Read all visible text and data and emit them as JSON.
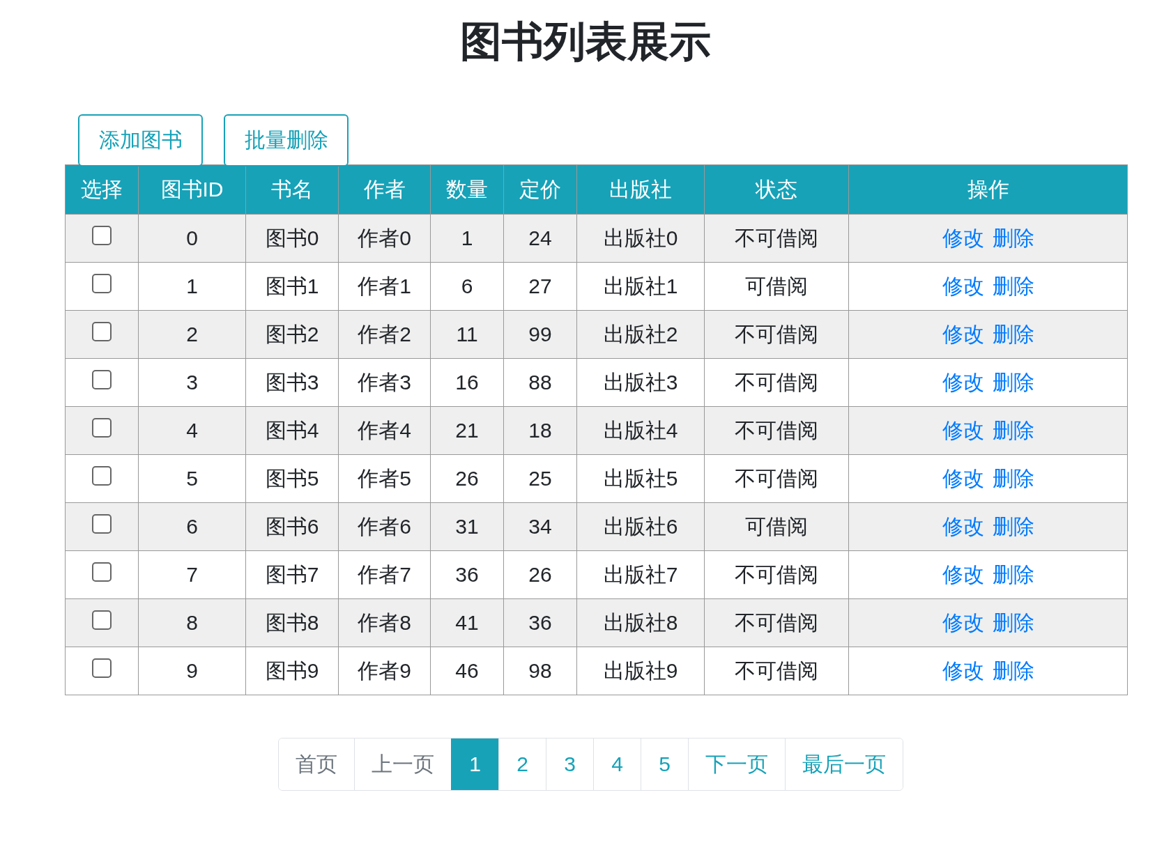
{
  "title": "图书列表展示",
  "toolbar": {
    "buttons": [
      "添加图书",
      "批量删除"
    ]
  },
  "table": {
    "columns": [
      "选择",
      "图书ID",
      "书名",
      "作者",
      "数量",
      "定价",
      "出版社",
      "状态",
      "操作"
    ],
    "rows": [
      {
        "checked": false,
        "id": "0",
        "name": "图书0",
        "author": "作者0",
        "count": "1",
        "price": "24",
        "publisher": "出版社0",
        "status": "不可借阅",
        "actions": [
          "修改",
          "删除"
        ]
      },
      {
        "checked": false,
        "id": "1",
        "name": "图书1",
        "author": "作者1",
        "count": "6",
        "price": "27",
        "publisher": "出版社1",
        "status": "可借阅",
        "actions": [
          "修改",
          "删除"
        ]
      },
      {
        "checked": false,
        "id": "2",
        "name": "图书2",
        "author": "作者2",
        "count": "11",
        "price": "99",
        "publisher": "出版社2",
        "status": "不可借阅",
        "actions": [
          "修改",
          "删除"
        ]
      },
      {
        "checked": false,
        "id": "3",
        "name": "图书3",
        "author": "作者3",
        "count": "16",
        "price": "88",
        "publisher": "出版社3",
        "status": "不可借阅",
        "actions": [
          "修改",
          "删除"
        ]
      },
      {
        "checked": false,
        "id": "4",
        "name": "图书4",
        "author": "作者4",
        "count": "21",
        "price": "18",
        "publisher": "出版社4",
        "status": "不可借阅",
        "actions": [
          "修改",
          "删除"
        ]
      },
      {
        "checked": false,
        "id": "5",
        "name": "图书5",
        "author": "作者5",
        "count": "26",
        "price": "25",
        "publisher": "出版社5",
        "status": "不可借阅",
        "actions": [
          "修改",
          "删除"
        ]
      },
      {
        "checked": false,
        "id": "6",
        "name": "图书6",
        "author": "作者6",
        "count": "31",
        "price": "34",
        "publisher": "出版社6",
        "status": "可借阅",
        "actions": [
          "修改",
          "删除"
        ]
      },
      {
        "checked": false,
        "id": "7",
        "name": "图书7",
        "author": "作者7",
        "count": "36",
        "price": "26",
        "publisher": "出版社7",
        "status": "不可借阅",
        "actions": [
          "修改",
          "删除"
        ]
      },
      {
        "checked": false,
        "id": "8",
        "name": "图书8",
        "author": "作者8",
        "count": "41",
        "price": "36",
        "publisher": "出版社8",
        "status": "不可借阅",
        "actions": [
          "修改",
          "删除"
        ]
      },
      {
        "checked": false,
        "id": "9",
        "name": "图书9",
        "author": "作者9",
        "count": "46",
        "price": "98",
        "publisher": "出版社9",
        "status": "不可借阅",
        "actions": [
          "修改",
          "删除"
        ]
      }
    ]
  },
  "pagination": [
    {
      "label": "首页",
      "kind": "nav",
      "disabled": true,
      "selected": false
    },
    {
      "label": "上一页",
      "kind": "nav",
      "disabled": true,
      "selected": false
    },
    {
      "label": "1",
      "kind": "page",
      "disabled": false,
      "selected": true
    },
    {
      "label": "2",
      "kind": "page",
      "disabled": false,
      "selected": false
    },
    {
      "label": "3",
      "kind": "page",
      "disabled": false,
      "selected": false
    },
    {
      "label": "4",
      "kind": "page",
      "disabled": false,
      "selected": false
    },
    {
      "label": "5",
      "kind": "page",
      "disabled": false,
      "selected": false
    },
    {
      "label": "下一页",
      "kind": "nav",
      "disabled": false,
      "selected": false
    },
    {
      "label": "最后一页",
      "kind": "nav",
      "disabled": false,
      "selected": false
    }
  ]
}
